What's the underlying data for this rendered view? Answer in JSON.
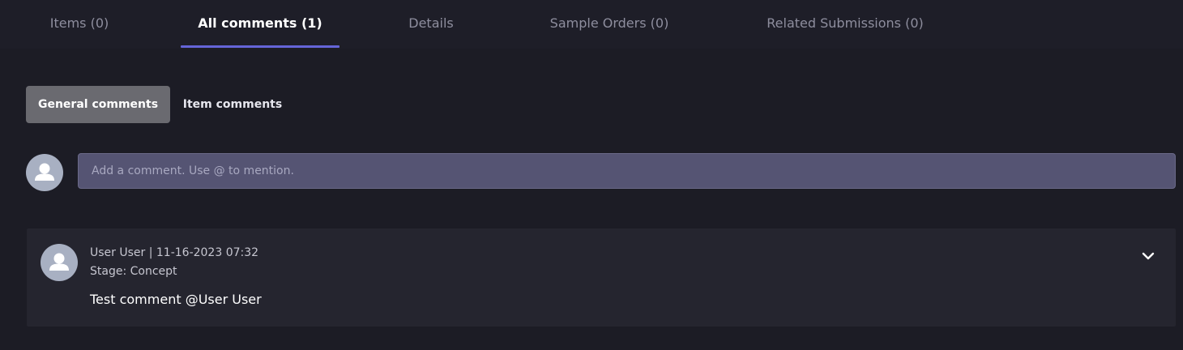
{
  "tabs": [
    {
      "label": "Items (0)"
    },
    {
      "label": "All comments (1)"
    },
    {
      "label": "Details"
    },
    {
      "label": "Sample Orders (0)"
    },
    {
      "label": "Related Submissions (0)"
    }
  ],
  "subtabs": [
    {
      "label": "General comments"
    },
    {
      "label": "Item comments"
    }
  ],
  "composer": {
    "placeholder": "Add a comment. Use @ to mention.",
    "avatar_icon": "user-avatar-icon"
  },
  "comments": [
    {
      "author_line": "User User | 11-16-2023 07:32",
      "stage": "Stage: Concept",
      "text": "Test comment @User User",
      "avatar_icon": "user-avatar-icon",
      "expand_icon": "chevron-down-icon"
    }
  ],
  "colors": {
    "background": "#1c1c25",
    "active_tab_underline": "#6565d8",
    "input_background": "#555473",
    "card_background": "#25252f",
    "active_subtab": "#6a6a70"
  }
}
